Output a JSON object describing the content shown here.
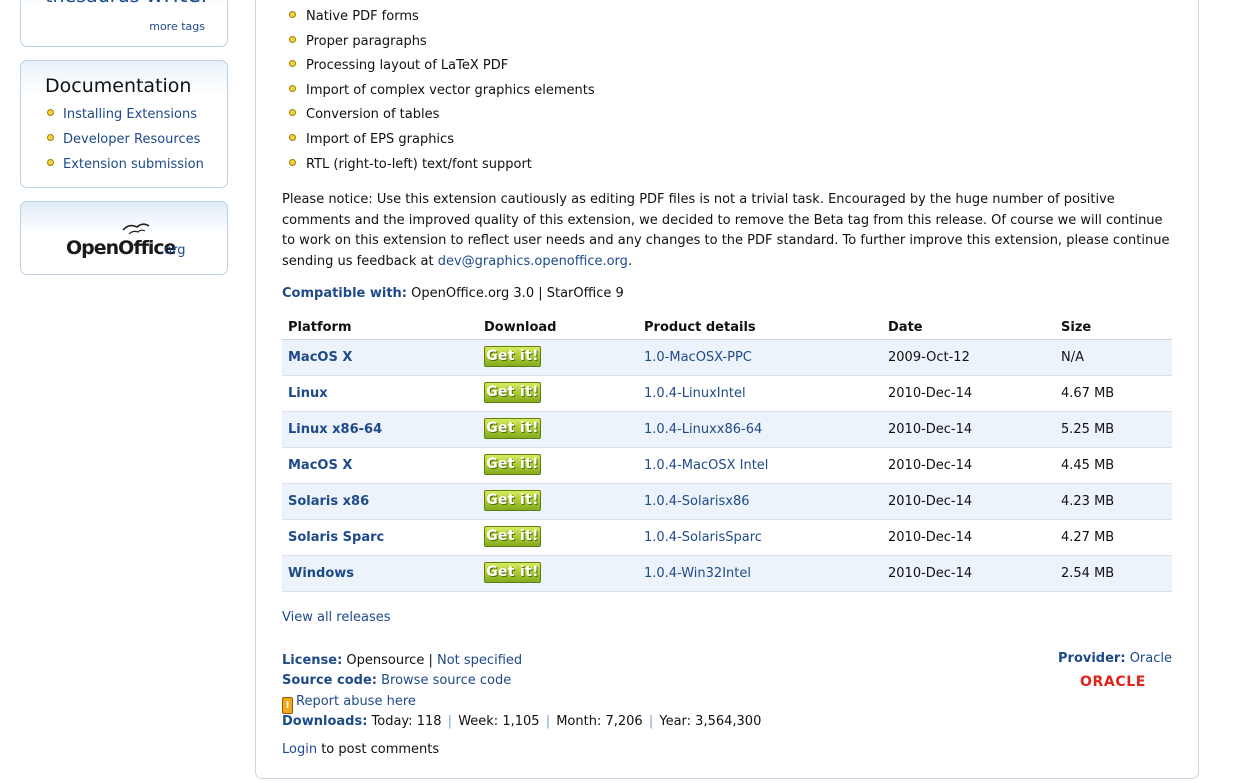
{
  "sidebar": {
    "tags": {
      "visible": "thesaurus",
      "visible_big": "writer",
      "more_label": "more tags"
    },
    "documentation": {
      "title": "Documentation",
      "items": [
        "Installing Extensions",
        "Developer Resources",
        "Extension submission"
      ]
    },
    "logo": {
      "brand": "OpenOffice",
      "suffix": ".org"
    }
  },
  "main": {
    "features": [
      "Native PDF forms",
      "Proper paragraphs",
      "Processing layout of LaTeX PDF",
      "Import of complex vector graphics elements",
      "Conversion of tables",
      "Import of EPS graphics",
      "RTL (right-to-left) text/font support"
    ],
    "notice": {
      "text": "Please notice: Use this extension cautiously as editing PDF files is not a trivial task. Encouraged by the huge number of positive comments and the improved quality of this extension, we decided to remove the Beta tag from this release. Of course we will continue to work on this extension to reflect user needs and any changes to the PDF standard. To further improve this extension, please continue sending us feedback at ",
      "email": "dev@graphics.openoffice.org",
      "end": "."
    },
    "compatible": {
      "label": "Compatible with:",
      "value": "OpenOffice.org 3.0 | StarOffice 9"
    },
    "table": {
      "headers": [
        "Platform",
        "Download",
        "Product details",
        "Date",
        "Size"
      ],
      "button_label": "Get it!",
      "rows": [
        {
          "platform": "MacOS X",
          "details": "1.0-MacOSX-PPC",
          "date": "2009-Oct-12",
          "size": "N/A"
        },
        {
          "platform": "Linux",
          "details": "1.0.4-LinuxIntel",
          "date": "2010-Dec-14",
          "size": "4.67 MB"
        },
        {
          "platform": "Linux x86-64",
          "details": "1.0.4-Linuxx86-64",
          "date": "2010-Dec-14",
          "size": "5.25 MB"
        },
        {
          "platform": "MacOS X",
          "details": "1.0.4-MacOSX Intel",
          "date": "2010-Dec-14",
          "size": "4.45 MB"
        },
        {
          "platform": "Solaris x86",
          "details": "1.0.4-Solarisx86",
          "date": "2010-Dec-14",
          "size": "4.23 MB"
        },
        {
          "platform": "Solaris Sparc",
          "details": "1.0.4-SolarisSparc",
          "date": "2010-Dec-14",
          "size": "4.27 MB"
        },
        {
          "platform": "Windows",
          "details": "1.0.4-Win32Intel",
          "date": "2010-Dec-14",
          "size": "2.54 MB"
        }
      ]
    },
    "view_all": "View all releases",
    "license": {
      "label": "License:",
      "value": "Opensource",
      "sep": "|",
      "link": "Not specified"
    },
    "source": {
      "label": "Source code:",
      "link": "Browse source code"
    },
    "abuse": {
      "icon": "!",
      "link": "Report abuse here"
    },
    "downloads": {
      "label": "Downloads:",
      "today": "Today: 118",
      "week": "Week: 1,105",
      "month": "Month: 7,206",
      "year": "Year: 3,564,300",
      "sep": "|"
    },
    "login": {
      "link": "Login",
      "rest": " to post comments"
    },
    "provider": {
      "label": "Provider:",
      "link": "Oracle",
      "logo_text": "ORACLE"
    }
  },
  "colors": {
    "link": "#1e4a8a",
    "button": "#a6c832",
    "oracle": "#e2231a"
  }
}
